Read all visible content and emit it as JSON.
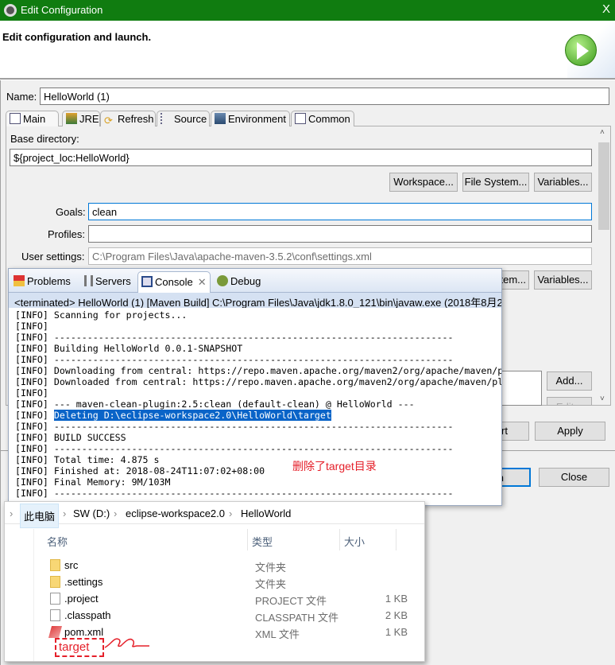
{
  "window": {
    "title": "Edit Configuration",
    "close": "X"
  },
  "header": {
    "message": "Edit configuration and launch."
  },
  "name": {
    "label": "Name:",
    "value": "HelloWorld (1)"
  },
  "tabs": [
    {
      "label": "Main"
    },
    {
      "label": "JRE"
    },
    {
      "label": "Refresh"
    },
    {
      "label": "Source"
    },
    {
      "label": "Environment"
    },
    {
      "label": "Common"
    }
  ],
  "main": {
    "base_dir_label": "Base directory:",
    "base_dir_value": "${project_loc:HelloWorld}",
    "workspace_btn": "Workspace...",
    "filesystem_btn": "File System...",
    "variables_btn": "Variables...",
    "goals_label": "Goals:",
    "goals_value": "clean",
    "profiles_label": "Profiles:",
    "profiles_value": "",
    "user_settings_label": "User settings:",
    "user_settings_value": "C:\\Program Files\\Java\\apache-maven-3.5.2\\conf\\settings.xml",
    "filesystem_btn2_partial": "tem...",
    "variables_btn2": "Variables...",
    "add_btn": "Add...",
    "edit_btn_partial": "Edit..."
  },
  "footer": {
    "revert_partial": "rt",
    "apply": "Apply",
    "run_partial": "n",
    "close": "Close"
  },
  "console": {
    "tabs": [
      {
        "label": "Problems"
      },
      {
        "label": "Servers"
      },
      {
        "label": "Console"
      },
      {
        "label": "Debug"
      }
    ],
    "header": "<terminated> HelloWorld (1) [Maven Build] C:\\Program Files\\Java\\jdk1.8.0_121\\bin\\javaw.exe (2018年8月2",
    "lines": [
      {
        "p": "[INFO] ",
        "m": "Scanning for projects..."
      },
      {
        "p": "[INFO]",
        "m": ""
      },
      {
        "p": "[INFO] ",
        "m": "------------------------------------------------------------------------"
      },
      {
        "p": "[INFO] ",
        "m": "Building HelloWorld 0.0.1-SNAPSHOT"
      },
      {
        "p": "[INFO] ",
        "m": "------------------------------------------------------------------------"
      },
      {
        "p": "[INFO] ",
        "m": "Downloading from central: https://repo.maven.apache.org/maven2/org/apache/maven/p"
      },
      {
        "p": "[INFO] ",
        "m": "Downloaded from central: https://repo.maven.apache.org/maven2/org/apache/maven/pl"
      },
      {
        "p": "[INFO]",
        "m": ""
      },
      {
        "p": "[INFO] ",
        "m": "--- maven-clean-plugin:2.5:clean (default-clean) @ HelloWorld ---"
      },
      {
        "p": "[INFO] ",
        "m": "Deleting D:\\eclipse-workspace2.0\\HelloWorld\\target",
        "highlight": true
      },
      {
        "p": "[INFO] ",
        "m": "------------------------------------------------------------------------"
      },
      {
        "p": "[INFO] ",
        "m": "BUILD SUCCESS"
      },
      {
        "p": "[INFO] ",
        "m": "------------------------------------------------------------------------"
      },
      {
        "p": "[INFO] ",
        "m": "Total time: 4.875 s"
      },
      {
        "p": "[INFO] ",
        "m": "Finished at: 2018-08-24T11:07:02+08:00"
      },
      {
        "p": "[INFO] ",
        "m": "Final Memory: 9M/103M"
      },
      {
        "p": "[INFO] ",
        "m": "------------------------------------------------------------------------"
      }
    ]
  },
  "annotation": {
    "text": "删除了target目录",
    "target": "target",
    "color": "#e5202a"
  },
  "explorer": {
    "breadcrumb": [
      "此电脑",
      "SW (D:)",
      "eclipse-workspace2.0",
      "HelloWorld"
    ],
    "columns": {
      "name": "名称",
      "type": "类型",
      "size": "大小"
    },
    "files": [
      {
        "name": "src",
        "type": "文件夹",
        "size": "",
        "icon": "folder"
      },
      {
        "name": ".settings",
        "type": "文件夹",
        "size": "",
        "icon": "folder"
      },
      {
        "name": ".project",
        "type": "PROJECT 文件",
        "size": "1 KB",
        "icon": "file"
      },
      {
        "name": ".classpath",
        "type": "CLASSPATH 文件",
        "size": "2 KB",
        "icon": "file"
      },
      {
        "name": "pom.xml",
        "type": "XML 文件",
        "size": "1 KB",
        "icon": "xml"
      }
    ]
  }
}
